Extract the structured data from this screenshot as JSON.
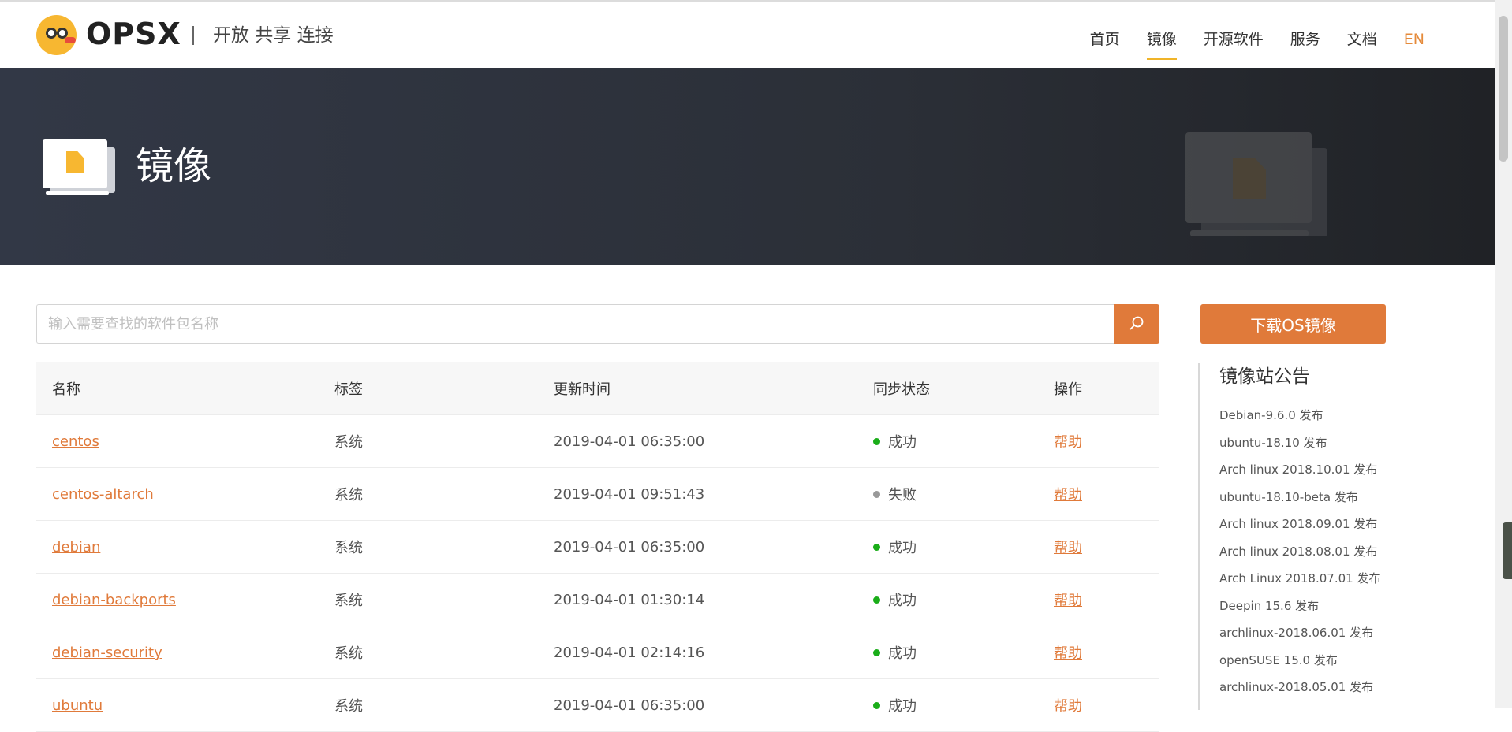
{
  "header": {
    "brand": "OPSX",
    "slogan": "开放 共享 连接",
    "nav": [
      {
        "label": "首页",
        "active": false
      },
      {
        "label": "镜像",
        "active": true
      },
      {
        "label": "开源软件",
        "active": false
      },
      {
        "label": "服务",
        "active": false
      },
      {
        "label": "文档",
        "active": false
      },
      {
        "label": "EN",
        "active": false
      }
    ]
  },
  "banner": {
    "title": "镜像",
    "icon": "document-icon"
  },
  "search": {
    "placeholder": "输入需要查找的软件包名称",
    "icon": "search-icon"
  },
  "table": {
    "headers": [
      "名称",
      "标签",
      "更新时间",
      "同步状态",
      "操作"
    ],
    "rows": [
      {
        "name": "centos",
        "tag": "系统",
        "time": "2019-04-01 06:35:00",
        "status": "成功",
        "status_color": "#1aad19",
        "action": "帮助"
      },
      {
        "name": "centos-altarch",
        "tag": "系统",
        "time": "2019-04-01 09:51:43",
        "status": "失败",
        "status_color": "#999999",
        "action": "帮助"
      },
      {
        "name": "debian",
        "tag": "系统",
        "time": "2019-04-01 06:35:00",
        "status": "成功",
        "status_color": "#1aad19",
        "action": "帮助"
      },
      {
        "name": "debian-backports",
        "tag": "系统",
        "time": "2019-04-01 01:30:14",
        "status": "成功",
        "status_color": "#1aad19",
        "action": "帮助"
      },
      {
        "name": "debian-security",
        "tag": "系统",
        "time": "2019-04-01 02:14:16",
        "status": "成功",
        "status_color": "#1aad19",
        "action": "帮助"
      },
      {
        "name": "ubuntu",
        "tag": "系统",
        "time": "2019-04-01 06:35:00",
        "status": "成功",
        "status_color": "#1aad19",
        "action": "帮助"
      }
    ]
  },
  "sidebar": {
    "download_button": "下载OS镜像",
    "notice_title": "镜像站公告",
    "notices": [
      "Debian-9.6.0 发布",
      "ubuntu-18.10 发布",
      "Arch linux 2018.10.01 发布",
      "ubuntu-18.10-beta 发布",
      "Arch linux 2018.09.01 发布",
      "Arch linux 2018.08.01 发布",
      "Arch Linux 2018.07.01 发布",
      "Deepin 15.6 发布",
      "archlinux-2018.06.01 发布",
      "openSUSE 15.0 发布",
      "archlinux-2018.05.01 发布"
    ]
  },
  "colors": {
    "accent": "#e07a3a",
    "nav_underline": "#f0b429",
    "success": "#1aad19",
    "failure": "#999999",
    "banner_bg": "#2b2f37"
  }
}
